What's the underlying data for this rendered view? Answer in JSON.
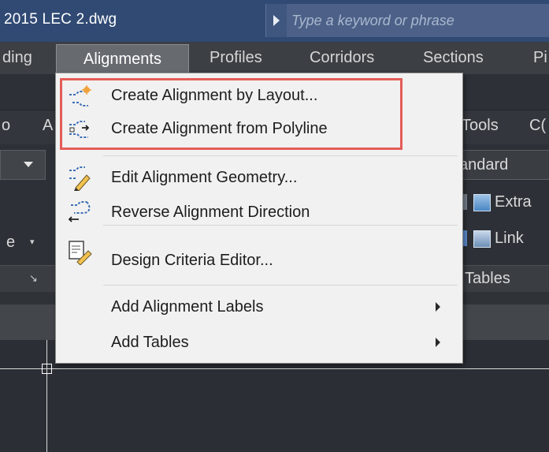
{
  "title_bar": {
    "title": "2015   LEC 2.dwg",
    "search_placeholder": "Type a keyword or phrase"
  },
  "menu_bar": {
    "items": [
      {
        "label": "ding"
      },
      {
        "label": "Alignments"
      },
      {
        "label": "Profiles"
      },
      {
        "label": "Corridors"
      },
      {
        "label": "Sections"
      },
      {
        "label": "Pi"
      }
    ]
  },
  "ribbon": {
    "tab_left_1": "o",
    "tab_left_2": "A",
    "tab_tools": "Tools",
    "tab_co": "C(",
    "standard": "andard",
    "extra": "Extra",
    "link": "Link",
    "tables": "Tables",
    "left_label": "e"
  },
  "dropdown": {
    "items": [
      {
        "label": "Create Alignment by Layout..."
      },
      {
        "label": "Create Alignment from Polyline"
      },
      {
        "label": "Edit Alignment Geometry..."
      },
      {
        "label": "Reverse Alignment Direction"
      },
      {
        "label": "Design Criteria Editor..."
      },
      {
        "label": "Add Alignment Labels"
      },
      {
        "label": "Add Tables"
      }
    ]
  },
  "colors": {
    "title_bar": "#304a74",
    "menu_bar": "#3c3f43",
    "active_menu": "#676b70",
    "highlight_border": "#e55c58",
    "dropdown_bg": "#f1f1f1"
  }
}
